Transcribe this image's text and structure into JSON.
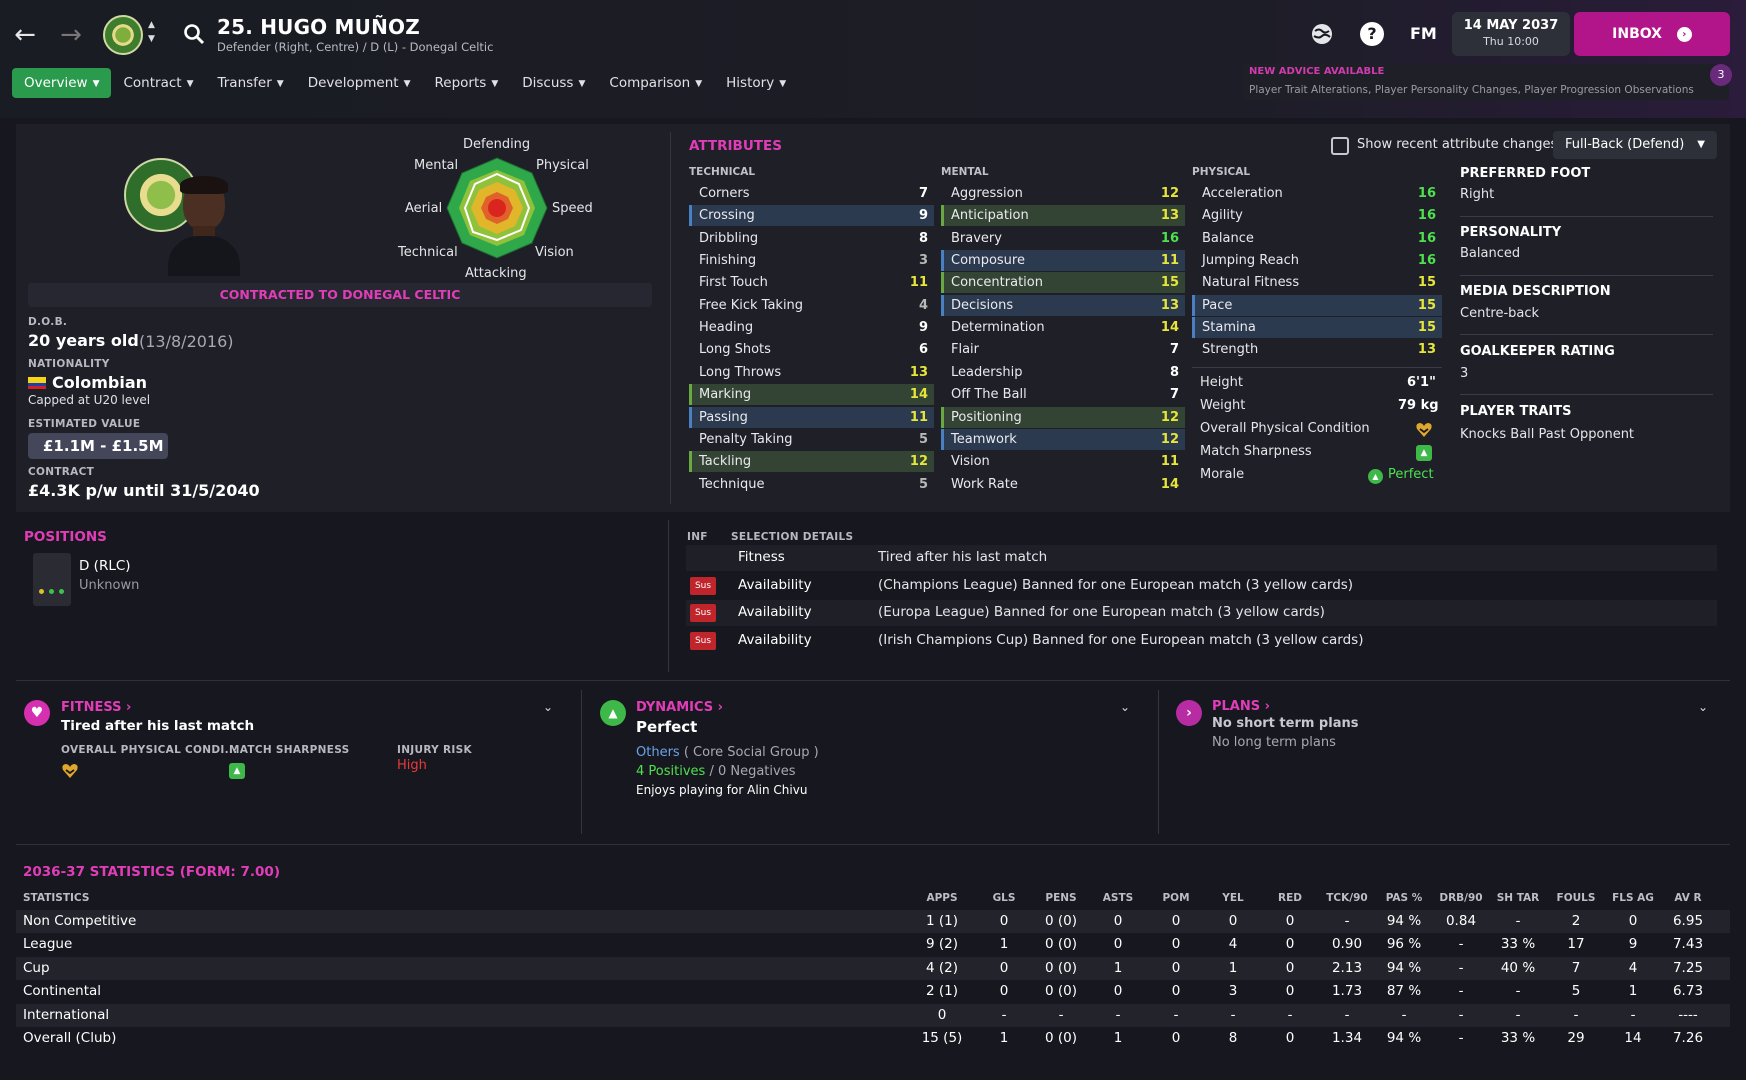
{
  "header": {
    "player_name": "25. HUGO MUÑOZ",
    "player_sub": "Defender (Right, Centre) / D (L) - Donegal Celtic",
    "fm_label": "FM",
    "date_main": "14 MAY 2037",
    "date_sub": "Thu 10:00",
    "inbox_label": "INBOX"
  },
  "tabs": [
    {
      "label": "Overview"
    },
    {
      "label": "Contract"
    },
    {
      "label": "Transfer"
    },
    {
      "label": "Development"
    },
    {
      "label": "Reports"
    },
    {
      "label": "Discuss"
    },
    {
      "label": "Comparison"
    },
    {
      "label": "History"
    }
  ],
  "advice": {
    "title": "NEW ADVICE AVAILABLE",
    "body": "Player Trait Alterations, Player Personality Changes, Player Progression Observations",
    "count": "3"
  },
  "profile": {
    "radar_labels": {
      "defending": "Defending",
      "physical": "Physical",
      "speed": "Speed",
      "vision": "Vision",
      "attacking": "Attacking",
      "technical": "Technical",
      "aerial": "Aerial",
      "mental": "Mental"
    },
    "contracted_text": "CONTRACTED TO DONEGAL CELTIC",
    "dob_label": "D.O.B.",
    "age": "20 years old",
    "dob": "(13/8/2016)",
    "nationality_label": "NATIONALITY",
    "nationality": "Colombian",
    "capped": "Capped at U20 level",
    "value_label": "ESTIMATED VALUE",
    "value": "£1.1M - £1.5M",
    "contract_label": "CONTRACT",
    "contract": "£4.3K p/w until 31/5/2040"
  },
  "attributes": {
    "title": "ATTRIBUTES",
    "show_changes_label": "Show recent attribute changes",
    "role_select": "Full-Back (Defend)",
    "technical_title": "TECHNICAL",
    "mental_title": "MENTAL",
    "physical_title": "PHYSICAL",
    "technical": [
      {
        "name": "Corners",
        "value": "7",
        "hl": "plain",
        "color": "v-white"
      },
      {
        "name": "Crossing",
        "value": "9",
        "hl": "hl-blue",
        "color": "v-white"
      },
      {
        "name": "Dribbling",
        "value": "8",
        "hl": "plain",
        "color": "v-white"
      },
      {
        "name": "Finishing",
        "value": "3",
        "hl": "plain",
        "color": "v-grey"
      },
      {
        "name": "First Touch",
        "value": "11",
        "hl": "plain",
        "color": "v-yellow"
      },
      {
        "name": "Free Kick Taking",
        "value": "4",
        "hl": "plain",
        "color": "v-grey"
      },
      {
        "name": "Heading",
        "value": "9",
        "hl": "plain",
        "color": "v-white"
      },
      {
        "name": "Long Shots",
        "value": "6",
        "hl": "plain",
        "color": "v-white"
      },
      {
        "name": "Long Throws",
        "value": "13",
        "hl": "plain",
        "color": "v-yellow"
      },
      {
        "name": "Marking",
        "value": "14",
        "hl": "hl-green",
        "color": "v-yellow"
      },
      {
        "name": "Passing",
        "value": "11",
        "hl": "hl-blue",
        "color": "v-yellow"
      },
      {
        "name": "Penalty Taking",
        "value": "5",
        "hl": "plain",
        "color": "v-grey"
      },
      {
        "name": "Tackling",
        "value": "12",
        "hl": "hl-green",
        "color": "v-yellow"
      },
      {
        "name": "Technique",
        "value": "5",
        "hl": "plain",
        "color": "v-grey"
      }
    ],
    "mental": [
      {
        "name": "Aggression",
        "value": "12",
        "hl": "plain",
        "color": "v-yellow"
      },
      {
        "name": "Anticipation",
        "value": "13",
        "hl": "hl-green",
        "color": "v-yellow"
      },
      {
        "name": "Bravery",
        "value": "16",
        "hl": "plain",
        "color": "v-green"
      },
      {
        "name": "Composure",
        "value": "11",
        "hl": "hl-blue",
        "color": "v-yellow"
      },
      {
        "name": "Concentration",
        "value": "15",
        "hl": "hl-green",
        "color": "v-yellow"
      },
      {
        "name": "Decisions",
        "value": "13",
        "hl": "hl-blue",
        "color": "v-yellow"
      },
      {
        "name": "Determination",
        "value": "14",
        "hl": "plain",
        "color": "v-yellow"
      },
      {
        "name": "Flair",
        "value": "7",
        "hl": "plain",
        "color": "v-white"
      },
      {
        "name": "Leadership",
        "value": "8",
        "hl": "plain",
        "color": "v-white"
      },
      {
        "name": "Off The Ball",
        "value": "7",
        "hl": "plain",
        "color": "v-white"
      },
      {
        "name": "Positioning",
        "value": "12",
        "hl": "hl-green",
        "color": "v-yellow"
      },
      {
        "name": "Teamwork",
        "value": "12",
        "hl": "hl-blue",
        "color": "v-yellow"
      },
      {
        "name": "Vision",
        "value": "11",
        "hl": "plain",
        "color": "v-yellow"
      },
      {
        "name": "Work Rate",
        "value": "14",
        "hl": "plain",
        "color": "v-yellow"
      }
    ],
    "physical": [
      {
        "name": "Acceleration",
        "value": "16",
        "hl": "plain",
        "color": "v-green"
      },
      {
        "name": "Agility",
        "value": "16",
        "hl": "plain",
        "color": "v-green"
      },
      {
        "name": "Balance",
        "value": "16",
        "hl": "plain",
        "color": "v-green"
      },
      {
        "name": "Jumping Reach",
        "value": "16",
        "hl": "plain",
        "color": "v-green"
      },
      {
        "name": "Natural Fitness",
        "value": "15",
        "hl": "plain",
        "color": "v-yellow"
      },
      {
        "name": "Pace",
        "value": "15",
        "hl": "hl-blue",
        "color": "v-yellow"
      },
      {
        "name": "Stamina",
        "value": "15",
        "hl": "hl-blue",
        "color": "v-yellow"
      },
      {
        "name": "Strength",
        "value": "13",
        "hl": "plain",
        "color": "v-yellow"
      }
    ],
    "extras": {
      "height_label": "Height",
      "height": "6'1\"",
      "weight_label": "Weight",
      "weight": "79 kg",
      "condition_label": "Overall Physical Condition",
      "sharpness_label": "Match Sharpness",
      "morale_label": "Morale",
      "morale": "Perfect"
    }
  },
  "side_info": {
    "foot_label": "PREFERRED FOOT",
    "foot": "Right",
    "personality_label": "PERSONALITY",
    "personality": "Balanced",
    "media_label": "MEDIA DESCRIPTION",
    "media": "Centre-back",
    "gk_label": "GOALKEEPER RATING",
    "gk": "3",
    "traits_label": "PLAYER TRAITS",
    "traits": "Knocks Ball Past Opponent"
  },
  "positions": {
    "title": "POSITIONS",
    "position": "D (RLC)",
    "familiarity": "Unknown"
  },
  "selection": {
    "inf_label": "INF",
    "details_label": "SELECTION DETAILS",
    "rows": [
      {
        "sus": "",
        "type": "Fitness",
        "detail": "Tired after his last match"
      },
      {
        "sus": "Sus",
        "type": "Availability",
        "detail": "(Champions League) Banned for one European match (3 yellow cards)"
      },
      {
        "sus": "Sus",
        "type": "Availability",
        "detail": "(Europa League) Banned for one European match (3 yellow cards)"
      },
      {
        "sus": "Sus",
        "type": "Availability",
        "detail": "(Irish Champions Cup) Banned for one European match (3 yellow cards)"
      }
    ]
  },
  "fitness_card": {
    "title": "FITNESS",
    "main": "Tired after his last match",
    "col1_label": "OVERALL PHYSICAL CONDI...",
    "col2_label": "MATCH SHARPNESS",
    "col3_label": "INJURY RISK",
    "injury_risk": "High"
  },
  "dynamics_card": {
    "title": "DYNAMICS",
    "main": "Perfect",
    "group_link": "Others",
    "group_text": "( Core Social Group )",
    "positives": "4 Positives",
    "negatives": "/ 0 Negatives",
    "note": "Enjoys playing for Alin Chivu"
  },
  "plans_card": {
    "title": "PLANS",
    "main": "No short term plans",
    "sub": "No long term plans"
  },
  "stats": {
    "title": "2036-37 STATISTICS (FORM: 7.00)",
    "columns": [
      "STATISTICS",
      "APPS",
      "GLS",
      "PENS",
      "ASTS",
      "POM",
      "YEL",
      "RED",
      "TCK/90",
      "PAS %",
      "DRB/90",
      "SH TAR",
      "FOULS",
      "FLS AG",
      "AV R"
    ],
    "rows": [
      [
        "Non Competitive",
        "1 (1)",
        "0",
        "0 (0)",
        "0",
        "0",
        "0",
        "0",
        "-",
        "94 %",
        "0.84",
        "-",
        "2",
        "0",
        "6.95"
      ],
      [
        "League",
        "9 (2)",
        "1",
        "0 (0)",
        "0",
        "0",
        "4",
        "0",
        "0.90",
        "96 %",
        "-",
        "33 %",
        "17",
        "9",
        "7.43"
      ],
      [
        "Cup",
        "4 (2)",
        "0",
        "0 (0)",
        "1",
        "0",
        "1",
        "0",
        "2.13",
        "94 %",
        "-",
        "40 %",
        "7",
        "4",
        "7.25"
      ],
      [
        "Continental",
        "2 (1)",
        "0",
        "0 (0)",
        "0",
        "0",
        "3",
        "0",
        "1.73",
        "87 %",
        "-",
        "-",
        "5",
        "1",
        "6.73"
      ],
      [
        "International",
        "0",
        "-",
        "-",
        "-",
        "-",
        "-",
        "-",
        "-",
        "-",
        "-",
        "-",
        "-",
        "-",
        "----"
      ],
      [
        "Overall (Club)",
        "15 (5)",
        "1",
        "0 (0)",
        "1",
        "0",
        "8",
        "0",
        "1.34",
        "94 %",
        "-",
        "33 %",
        "29",
        "14",
        "7.26"
      ]
    ]
  }
}
